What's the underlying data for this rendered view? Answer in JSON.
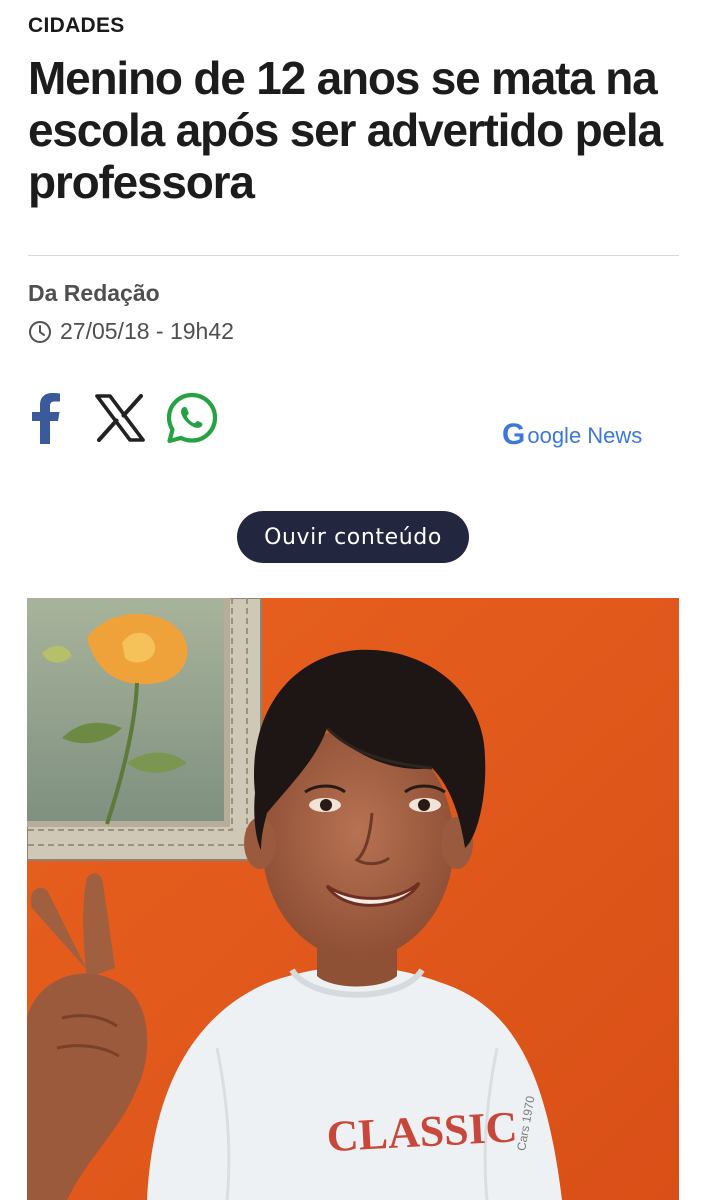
{
  "article": {
    "section": "CIDADES",
    "headline": "Menino de 12 anos se mata na escola após ser advertido pela professora",
    "author": "Da Redação",
    "datetime": "27/05/18 - 19h42"
  },
  "share": {
    "icons": [
      "facebook-icon",
      "x-icon",
      "whatsapp-icon"
    ],
    "google_news_g": "G",
    "google_news_label": "oogle News"
  },
  "audio": {
    "listen_label": "Ouvir conteúdo"
  },
  "photo": {
    "shirt_text": "CLASSIC",
    "shirt_small_text": "Cars 1970"
  },
  "colors": {
    "facebook": "#3b5a9a",
    "whatsapp": "#25a244",
    "google_news": "#3c78d8",
    "listen_button_bg": "#22263f",
    "wall_orange": "#e25a1c"
  }
}
